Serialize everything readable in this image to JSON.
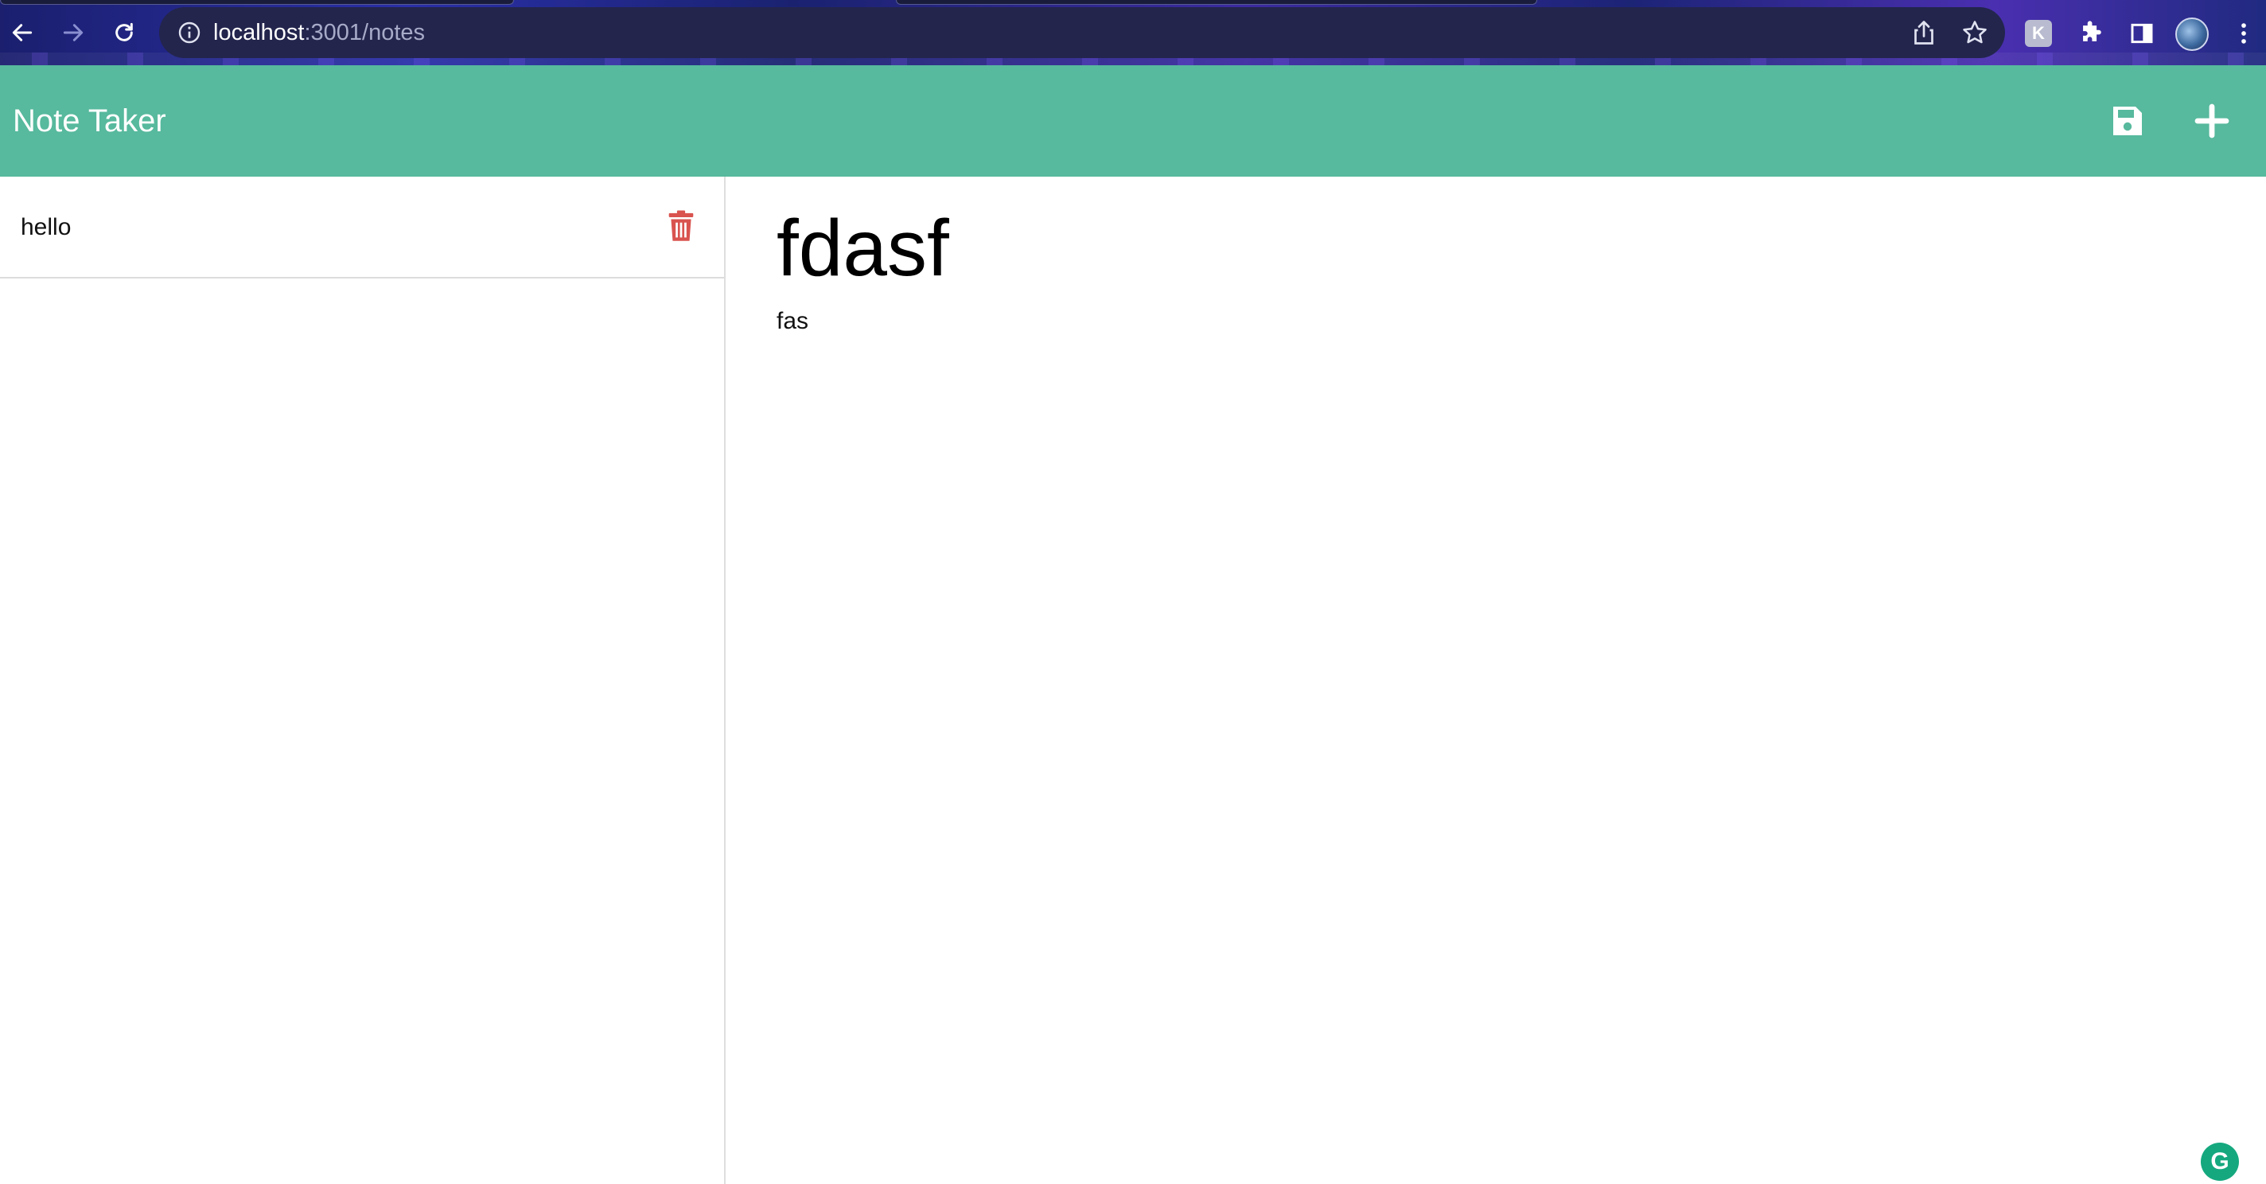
{
  "browser": {
    "url_host": "localhost",
    "url_rest": ":3001/notes"
  },
  "app": {
    "title": "Note Taker",
    "header_color": "#57b99d"
  },
  "notes": [
    {
      "title": "hello"
    }
  ],
  "active_note": {
    "title": "fdasf",
    "body": "fas"
  },
  "colors": {
    "delete_icon": "#d9534f",
    "header_icons": "#ffffff"
  },
  "icons": {
    "save": "floppy-disk-icon",
    "new": "plus-icon",
    "delete": "trash-icon"
  }
}
